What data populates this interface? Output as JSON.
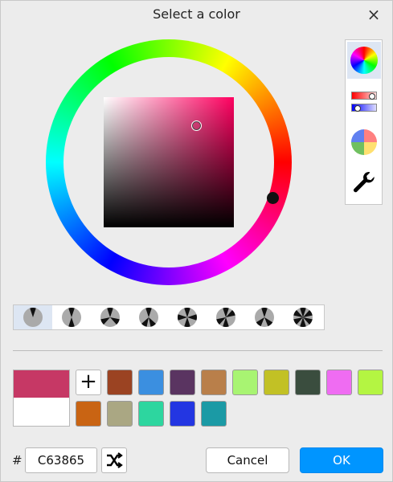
{
  "dialog": {
    "title": "Select a color",
    "close_label": "×"
  },
  "color": {
    "current_hex": "C63865",
    "new_color": "#c63865",
    "old_color": "#ffffff",
    "hash_label": "#"
  },
  "modes": [
    "color-wheel",
    "sliders",
    "palette-wheel",
    "settings"
  ],
  "harmony_modes": [
    "single",
    "complementary",
    "triad",
    "analogous-3",
    "tetrad",
    "square",
    "split-complementary",
    "hexad"
  ],
  "palette": {
    "add_label": "+",
    "swatches": [
      "#9b4322",
      "#3b8fe0",
      "#5a3461",
      "#b97f4a",
      "#a8f472",
      "#c2c125",
      "#3a4d3e",
      "#ef6cf2",
      "#b4f542",
      "#c96413",
      "#aaa783",
      "#2dd69f",
      "#2336e2",
      "#1b9aa5"
    ]
  },
  "buttons": {
    "cancel": "Cancel",
    "ok": "OK"
  }
}
